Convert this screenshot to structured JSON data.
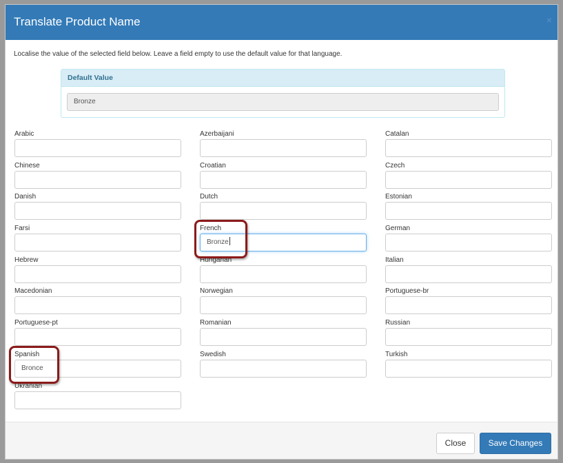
{
  "dialog": {
    "title": "Translate Product Name",
    "close_symbol": "×",
    "intro": "Localise the value of the selected field below. Leave a field empty to use the default value for that language."
  },
  "default_value": {
    "heading": "Default Value",
    "value": "Bronze"
  },
  "languages": [
    {
      "label": "Arabic",
      "value": ""
    },
    {
      "label": "Azerbaijani",
      "value": ""
    },
    {
      "label": "Catalan",
      "value": ""
    },
    {
      "label": "Chinese",
      "value": ""
    },
    {
      "label": "Croatian",
      "value": ""
    },
    {
      "label": "Czech",
      "value": ""
    },
    {
      "label": "Danish",
      "value": ""
    },
    {
      "label": "Dutch",
      "value": ""
    },
    {
      "label": "Estonian",
      "value": ""
    },
    {
      "label": "Farsi",
      "value": ""
    },
    {
      "label": "French",
      "value": "Bronze"
    },
    {
      "label": "German",
      "value": ""
    },
    {
      "label": "Hebrew",
      "value": ""
    },
    {
      "label": "Hungarian",
      "value": ""
    },
    {
      "label": "Italian",
      "value": ""
    },
    {
      "label": "Macedonian",
      "value": ""
    },
    {
      "label": "Norwegian",
      "value": ""
    },
    {
      "label": "Portuguese-br",
      "value": ""
    },
    {
      "label": "Portuguese-pt",
      "value": ""
    },
    {
      "label": "Romanian",
      "value": ""
    },
    {
      "label": "Russian",
      "value": ""
    },
    {
      "label": "Spanish",
      "value": "Bronce"
    },
    {
      "label": "Swedish",
      "value": ""
    },
    {
      "label": "Turkish",
      "value": ""
    },
    {
      "label": "Ukranian",
      "value": ""
    }
  ],
  "footer": {
    "close_label": "Close",
    "save_label": "Save Changes"
  },
  "colors": {
    "header_bg": "#337ab7",
    "primary_button": "#337ab7",
    "info_panel_bg": "#d9edf7",
    "callout_border": "#8b1a1a"
  }
}
